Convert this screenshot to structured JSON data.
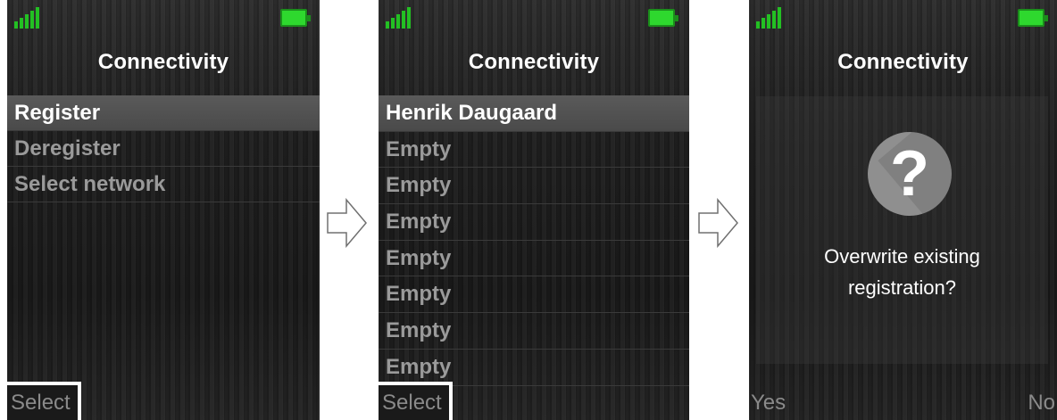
{
  "screens": [
    {
      "title": "Connectivity",
      "items": [
        "Register",
        "Deregister",
        "Select network"
      ],
      "selected_index": 0,
      "softkey_left": "Select"
    },
    {
      "title": "Connectivity",
      "items": [
        "Henrik Daugaard",
        "Empty",
        "Empty",
        "Empty",
        "Empty",
        "Empty",
        "Empty",
        "Empty"
      ],
      "selected_index": 0,
      "softkey_left": "Select"
    },
    {
      "title": "Connectivity",
      "dialog": {
        "icon": "question-icon",
        "glyph": "?",
        "line1": "Overwrite existing",
        "line2": "registration?"
      },
      "softkey_left": "Yes",
      "softkey_right": "No"
    }
  ],
  "colors": {
    "signal": "#23c023",
    "battery": "#2ed82e",
    "selected_row": "#555555",
    "inactive_text": "#9a9a9a"
  },
  "icons": {
    "signal": "signal-strength-icon",
    "battery": "battery-icon",
    "arrow": "arrow-right-icon"
  }
}
